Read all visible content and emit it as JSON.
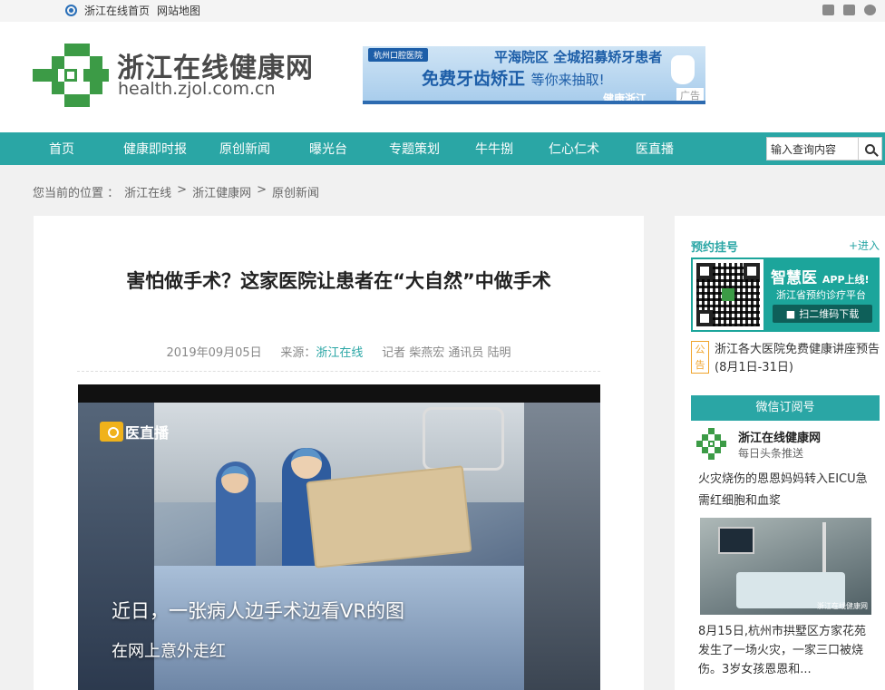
{
  "topbar": {
    "home_link": "浙江在线首页",
    "sitemap_link": "网站地图"
  },
  "header": {
    "site_name": "浙江在线健康网",
    "site_url": "health.zjol.com.cn",
    "ad": {
      "hospital": "杭州口腔医院",
      "line1": "平海院区  全城招募矫牙患者",
      "line2_main": "免费牙齿矫正",
      "line2_tail": "等你来抽取!",
      "line3": "健康浙江",
      "tag": "广告"
    }
  },
  "nav": {
    "items": [
      "首页",
      "健康即时报",
      "原创新闻",
      "曝光台",
      "专题策划",
      "牛牛捌",
      "仁心仁术",
      "医直播"
    ],
    "search_placeholder": "输入查询内容"
  },
  "breadcrumb": {
    "prefix": "您当前的位置 ：",
    "items": [
      "浙江在线",
      ">",
      "浙江健康网",
      ">",
      "原创新闻"
    ]
  },
  "article": {
    "title": "害怕做手术？这家医院让患者在“大自然”中做手术",
    "date": "2019年09月05日",
    "source_label": "来源：",
    "source": "浙江在线",
    "authors": "记者 柴燕宏 通讯员 陆明",
    "video": {
      "logo_text": "医直播",
      "caption1": "近日，一张病人边手术边看VR的图",
      "caption2": "在网上意外走红"
    }
  },
  "sidebar": {
    "booking_title": "预约挂号",
    "booking_more": "+进入",
    "qr": {
      "title": "智慧医",
      "title_suffix": "APP上线!",
      "subtitle": "浙江省预约诊疗平台",
      "button": "扫二维码下载"
    },
    "notice_tag": "公告",
    "notice_text": "浙江各大医院免费健康讲座预告(8月1日-31日)",
    "wechat_title": "微信订阅号",
    "wechat_name": "浙江在线健康网",
    "wechat_desc": "每日头条推送",
    "news1": "火灾烧伤的恩恩妈妈转入EICU急需红细胞和血浆",
    "news_img_watermark": "浙江在线健康网",
    "news2": "8月15日,杭州市拱墅区方家花苑发生了一场火灾，一家三口被烧伤。3岁女孩恩恩和..."
  },
  "colors": {
    "brand_teal": "#2aa6a5",
    "logo_green": "#3c9b46",
    "notice_orange": "#f0a42b"
  }
}
